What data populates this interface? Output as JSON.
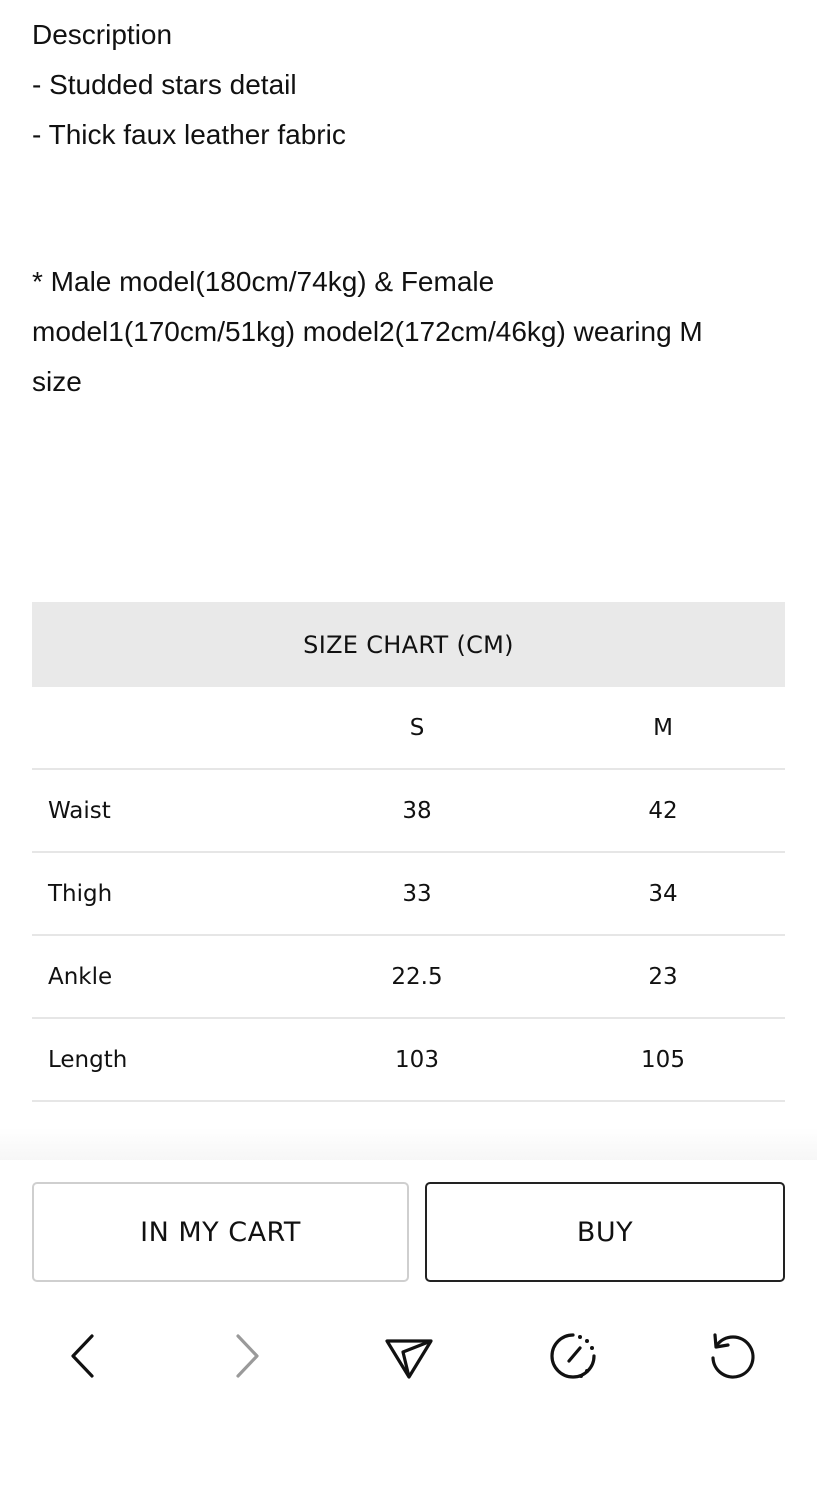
{
  "description": {
    "heading": "Description",
    "bullet_1": "- Studded stars detail",
    "bullet_2": "- Thick faux leather fabric",
    "model_note_line_1": "* Male model(180cm/74kg) & Female",
    "model_note_line_2": "model1(170cm/51kg) model2(172cm/46kg) wearing M",
    "model_note_line_3": "size"
  },
  "size_chart": {
    "title": "SIZE CHART (CM)",
    "columns": [
      "",
      "S",
      "M"
    ],
    "rows": [
      {
        "label": "Waist",
        "s": "38",
        "m": "42"
      },
      {
        "label": "Thigh",
        "s": "33",
        "m": "34"
      },
      {
        "label": "Ankle",
        "s": "22.5",
        "m": "23"
      },
      {
        "label": "Length",
        "s": "103",
        "m": "105"
      }
    ]
  },
  "actions": {
    "cart_label": "IN MY CART",
    "buy_label": "BUY"
  },
  "browser_nav": {
    "icons": [
      "back-icon",
      "forward-icon",
      "share-icon",
      "speed-icon",
      "reload-icon"
    ],
    "forward_enabled": false
  },
  "colors": {
    "header_bg": "#e9e9e9",
    "divider": "#e6e6e6",
    "buy_border": "#222222",
    "cart_border": "#cfcfcf",
    "icon": "#111111",
    "icon_disabled": "#9a9a9a"
  }
}
